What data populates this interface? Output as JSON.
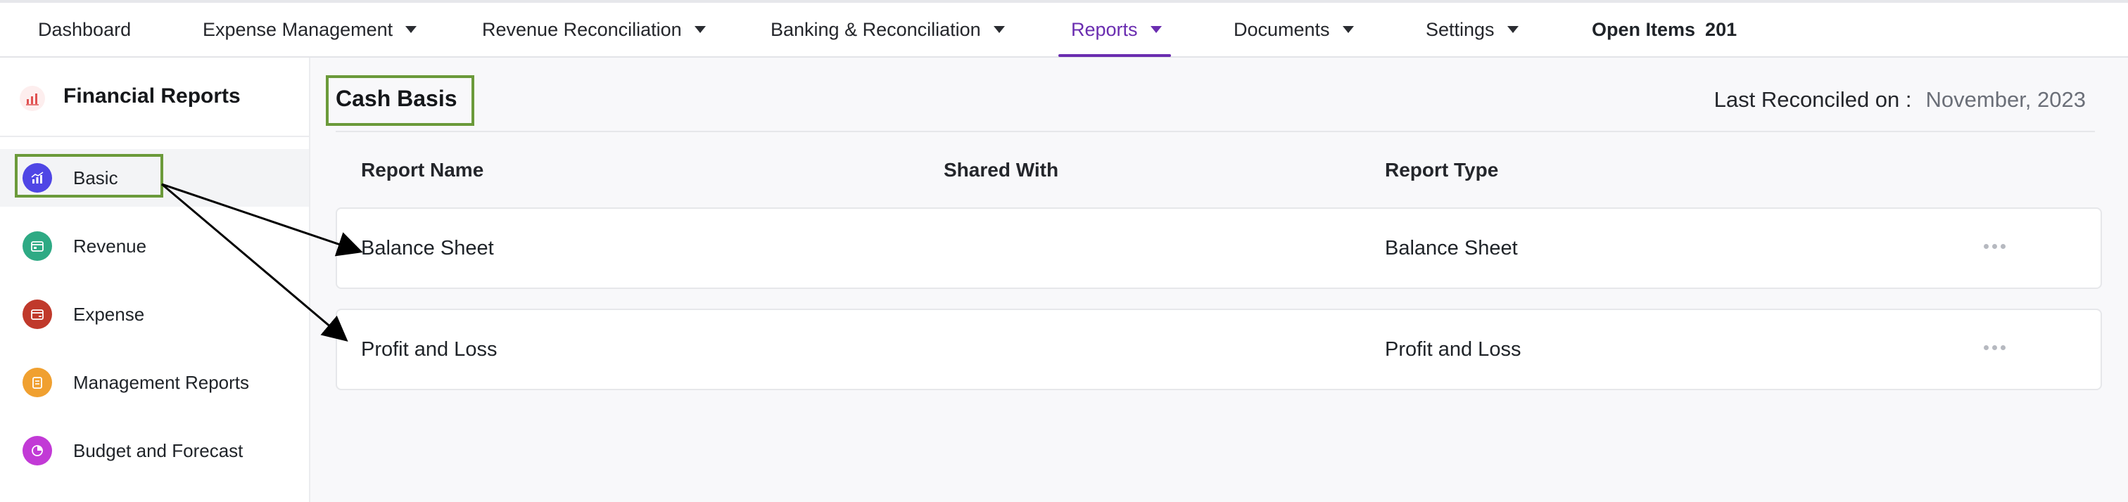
{
  "topnav": {
    "items": [
      {
        "label": "Dashboard",
        "dropdown": false
      },
      {
        "label": "Expense Management",
        "dropdown": true
      },
      {
        "label": "Revenue Reconciliation",
        "dropdown": true
      },
      {
        "label": "Banking & Reconciliation",
        "dropdown": true
      },
      {
        "label": "Reports",
        "dropdown": true,
        "active": true
      },
      {
        "label": "Documents",
        "dropdown": true
      },
      {
        "label": "Settings",
        "dropdown": true
      }
    ],
    "open_items_label": "Open Items",
    "open_items_count": "201"
  },
  "sidebar": {
    "title": "Financial Reports",
    "items": [
      {
        "label": "Basic",
        "icon": "chart-icon",
        "color": "#4f46e5",
        "active": true
      },
      {
        "label": "Revenue",
        "icon": "revenue-icon",
        "color": "#2eaa84"
      },
      {
        "label": "Expense",
        "icon": "expense-icon",
        "color": "#c0392b"
      },
      {
        "label": "Management Reports",
        "icon": "clipboard-icon",
        "color": "#f0a030"
      },
      {
        "label": "Budget and Forecast",
        "icon": "pie-icon",
        "color": "#c23ad6"
      }
    ]
  },
  "main": {
    "title": "Cash Basis",
    "last_reconciled_label": "Last Reconciled on :",
    "last_reconciled_value": "November, 2023",
    "table": {
      "headers": [
        "Report Name",
        "Shared With",
        "Report Type"
      ],
      "rows": [
        {
          "name": "Balance Sheet",
          "shared_with": "",
          "type": "Balance Sheet"
        },
        {
          "name": "Profit and Loss",
          "shared_with": "",
          "type": "Profit and Loss"
        }
      ]
    }
  },
  "colors": {
    "accent": "#6a2db0",
    "highlight_box": "#6b9a3a"
  }
}
